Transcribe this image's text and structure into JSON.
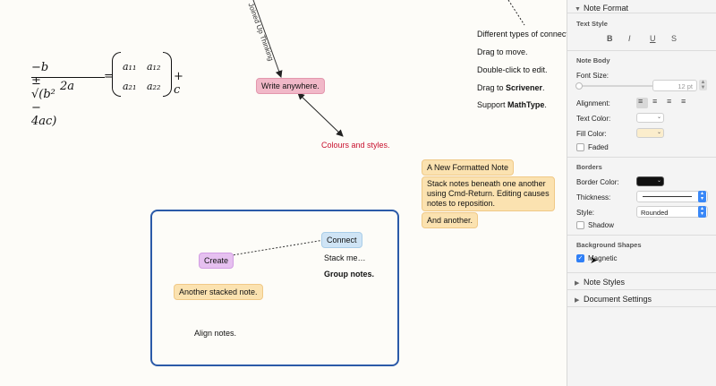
{
  "canvas": {
    "rotated_label": "Joined Up Thinking",
    "notes": {
      "write_anywhere": "Write anywhere.",
      "colours_styles": "Colours and styles.",
      "features": [
        "Different types of connectio",
        "Drag to move.",
        "Double-click to edit."
      ],
      "drag_to_prefix": "Drag to ",
      "drag_to_target": "Scrivener",
      "drag_to_suffix": ".",
      "support_prefix": "Support ",
      "support_target": "MathType",
      "support_suffix": ".",
      "new_formatted": "A New Formatted Note",
      "stack_long_1": "Stack notes beneath one another",
      "stack_long_2": "using Cmd-Return. Editing causes",
      "stack_long_3": "notes to reposition.",
      "and_another": "And another.",
      "connect": "Connect",
      "stack_me": "Stack me…",
      "group_notes": "Group notes.",
      "create": "Create",
      "another_stacked": "Another stacked note.",
      "align_notes": "Align notes."
    },
    "formula": {
      "numerator": "−b ± √(b² − 4ac)",
      "denominator": "2a",
      "equals": "=",
      "matrix": [
        "a₁₁",
        "a₁₂",
        "a₂₁",
        "a₂₂"
      ],
      "suffix": "+ c"
    }
  },
  "inspector": {
    "note_format": "Note Format",
    "text_style": "Text Style",
    "style_buttons": [
      "B",
      "I",
      "U",
      "S"
    ],
    "note_body": "Note Body",
    "font_size_label": "Font Size:",
    "font_size_value": "12 pt",
    "alignment_label": "Alignment:",
    "text_color_label": "Text Color:",
    "fill_color_label": "Fill Color:",
    "faded_label": "Faded",
    "borders": "Borders",
    "border_color_label": "Border Color:",
    "thickness_label": "Thickness:",
    "style_label": "Style:",
    "style_value": "Rounded",
    "shadow_label": "Shadow",
    "background_shapes": "Background Shapes",
    "magnetic_label": "Magnetic",
    "note_styles": "Note Styles",
    "document_settings": "Document Settings"
  },
  "colors": {
    "pink_note": "#f1b8c8",
    "yellow_note": "#fbe2b0",
    "lilac_note": "#e6c0f0",
    "blue_note": "#cfe4f5",
    "group_border": "#2b5aa8",
    "accent": "#2f7ff6"
  }
}
